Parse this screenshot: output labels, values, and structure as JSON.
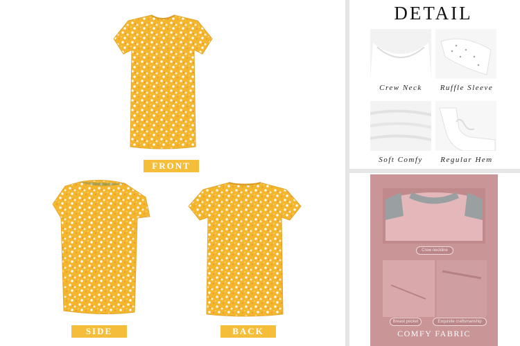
{
  "colors": {
    "accent": "#f5be3a",
    "fabric": "#f3b62d",
    "promo_bg": "#c99597"
  },
  "views": {
    "front": "FRONT",
    "side": "SIDE",
    "back": "BACK"
  },
  "detail": {
    "title": "DETAIL",
    "items": [
      {
        "caption": "Crew Neck",
        "icon": "crew-neck-photo"
      },
      {
        "caption": "Ruffle Sleeve",
        "icon": "ruffle-sleeve-photo"
      },
      {
        "caption": "Soft Comfy",
        "icon": "soft-fabric-photo"
      },
      {
        "caption": "Regular Hem",
        "icon": "hem-photo"
      }
    ]
  },
  "promo": {
    "neck_label": "Crew neckline",
    "pocket_label": "Breast pocket",
    "craft_label": "Exquisite craftsmanship",
    "title": "COMFY FABRIC"
  }
}
